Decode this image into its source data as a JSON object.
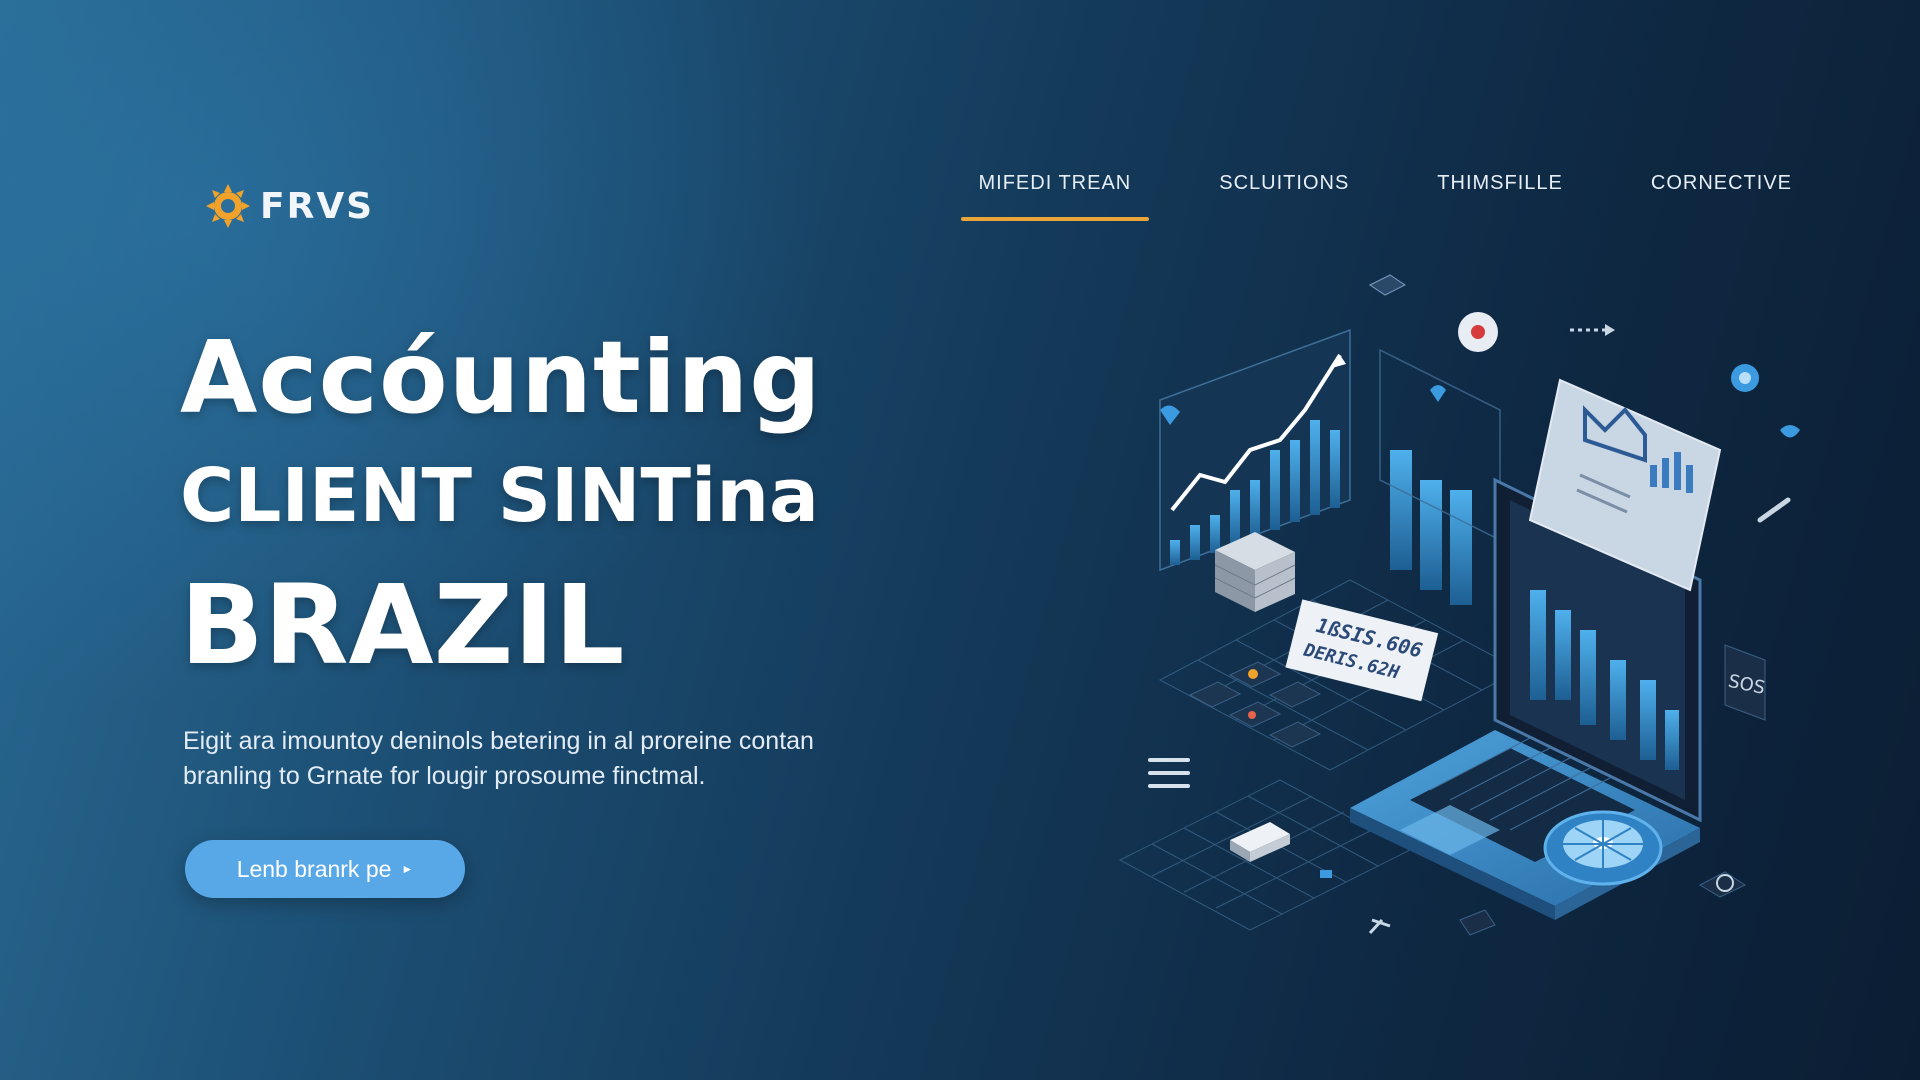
{
  "header": {
    "logo_text": "FRVS",
    "nav": [
      {
        "label": "MIFEDI TREAN",
        "active": true
      },
      {
        "label": "SCLUITIONS",
        "active": false
      },
      {
        "label": "THIMSFILLE",
        "active": false
      },
      {
        "label": "CORNECTIVE",
        "active": false
      }
    ]
  },
  "hero": {
    "title_line1": "Accóunting",
    "title_line2": "CLIENT SINTina",
    "title_line3": "BRAZIL",
    "description": "Eigit ara imountoy deninols betering in al proreine contan branling to Grnate for lougir prosoume finctmal.",
    "cta_label": "Lenb branrk pe",
    "cta_icon": "play-arrow-icon"
  },
  "illustration": {
    "receipt_line1": "1ßSIS.606",
    "receipt_line2": "DERIS.62H",
    "side_card_label": "SOS"
  },
  "colors": {
    "accent": "#e9a53a",
    "button": "#58a8e8",
    "background_dark": "#0b1d33",
    "background_light": "#2a6c96"
  }
}
